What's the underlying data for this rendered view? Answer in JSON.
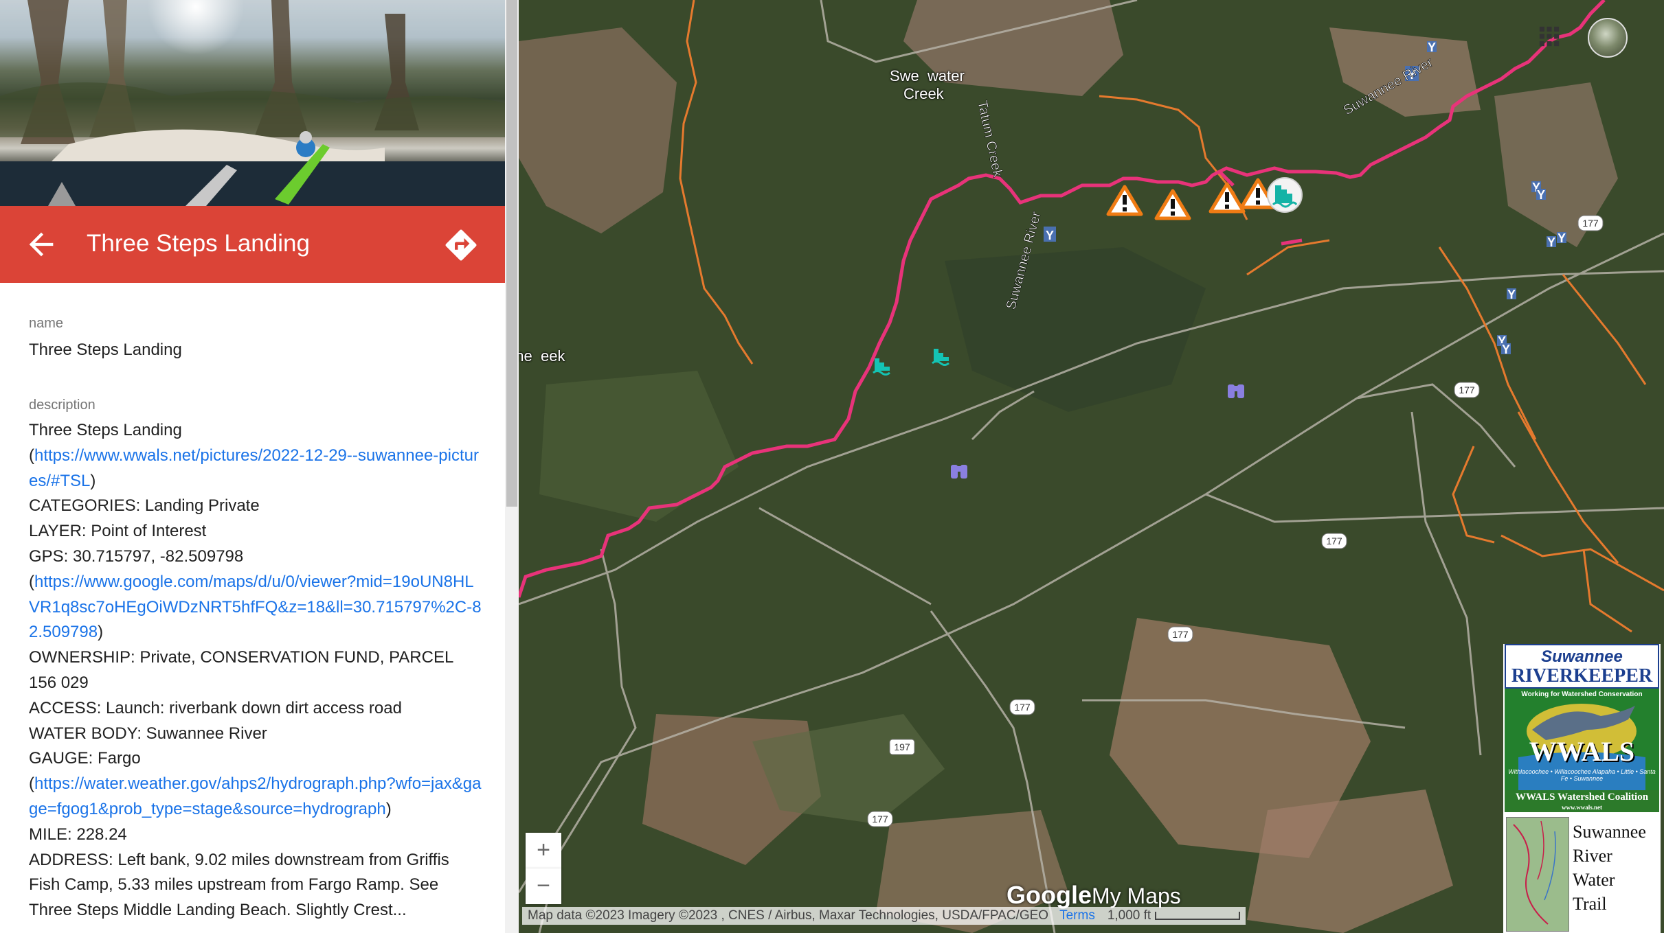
{
  "place": {
    "title": "Three Steps Landing",
    "name_label": "name",
    "name_value": "Three Steps Landing",
    "description_label": "description",
    "description": [
      {
        "text": "Three Steps Landing"
      },
      {
        "pre": "(",
        "link": "https://www.wwals.net/pictures/2022-12-29--suwannee-pictures/#TSL",
        "post": ")"
      },
      {
        "text": "CATEGORIES: Landing Private"
      },
      {
        "text": "LAYER: Point of Interest"
      },
      {
        "text": "GPS: 30.715797, -82.509798"
      },
      {
        "pre": "(",
        "link": "https://www.google.com/maps/d/u/0/viewer?mid=19oUN8HLVR1q8sc7oHEgOiWDzNRT5hfFQ&z=18&ll=30.715797%2C-82.509798",
        "post": ")"
      },
      {
        "text": "OWNERSHIP: Private, CONSERVATION FUND, PARCEL 156 029"
      },
      {
        "text": "ACCESS: Launch: riverbank down dirt access road"
      },
      {
        "text": "WATER BODY: Suwannee River"
      },
      {
        "text": "GAUGE: Fargo"
      },
      {
        "pre": "(",
        "link": "https://water.weather.gov/ahps2/hydrograph.php?wfo=jax&gage=fgog1&prob_type=stage&source=hydrograph",
        "post": ")"
      },
      {
        "text": "MILE: 228.24"
      },
      {
        "text": "ADDRESS: Left bank, 9.02 miles downstream from Griffis Fish Camp, 5.33 miles upstream from Fargo Ramp. See Three Steps Middle Landing Beach. Slightly Crest..."
      }
    ]
  },
  "icons": {
    "back": "arrow-left-icon",
    "directions": "directions-icon",
    "apps": "apps-grid-icon"
  },
  "map": {
    "labels": {
      "sweetwater_1": "Swe",
      "sweetwater_2": "water",
      "sweetwater_3": "Creek",
      "suwannee_ne": "Suwannee River",
      "tatum": "Tatum Creek",
      "jones_1": "Jone",
      "jones_2": "eek",
      "suwannee_w": "Suwannee River"
    },
    "road_shields": [
      "177",
      "177",
      "177",
      "177",
      "177",
      "197",
      "177"
    ],
    "zoom_in": "+",
    "zoom_out": "−",
    "attribution": "Map data ©2023 Imagery ©2023 , CNES / Airbus, Maxar Technologies, USDA/FPAC/GEO",
    "terms": "Terms",
    "scale": "1,000 ft",
    "logo_google": "Google",
    "logo_mymaps": "My Maps"
  },
  "legend": {
    "riverkeeper_top": "Suwannee",
    "riverkeeper_bottom": "RIVERKEEPER",
    "riverkeeper_tag": "Working for Watershed Conservation",
    "wwals": "WWALS",
    "wwals_rivers": "Withlacoochee • Willacoochee Alapaha • Little • Santa Fe • Suwannee",
    "coalition": "WWALS Watershed Coalition",
    "site": "www.wwals.net",
    "trail": [
      "Suwannee",
      "River",
      "Water",
      "Trail"
    ]
  },
  "colors": {
    "header": "#db4437",
    "link": "#1a73e8",
    "river": "#e8337a",
    "creek": "#e57a2e"
  }
}
